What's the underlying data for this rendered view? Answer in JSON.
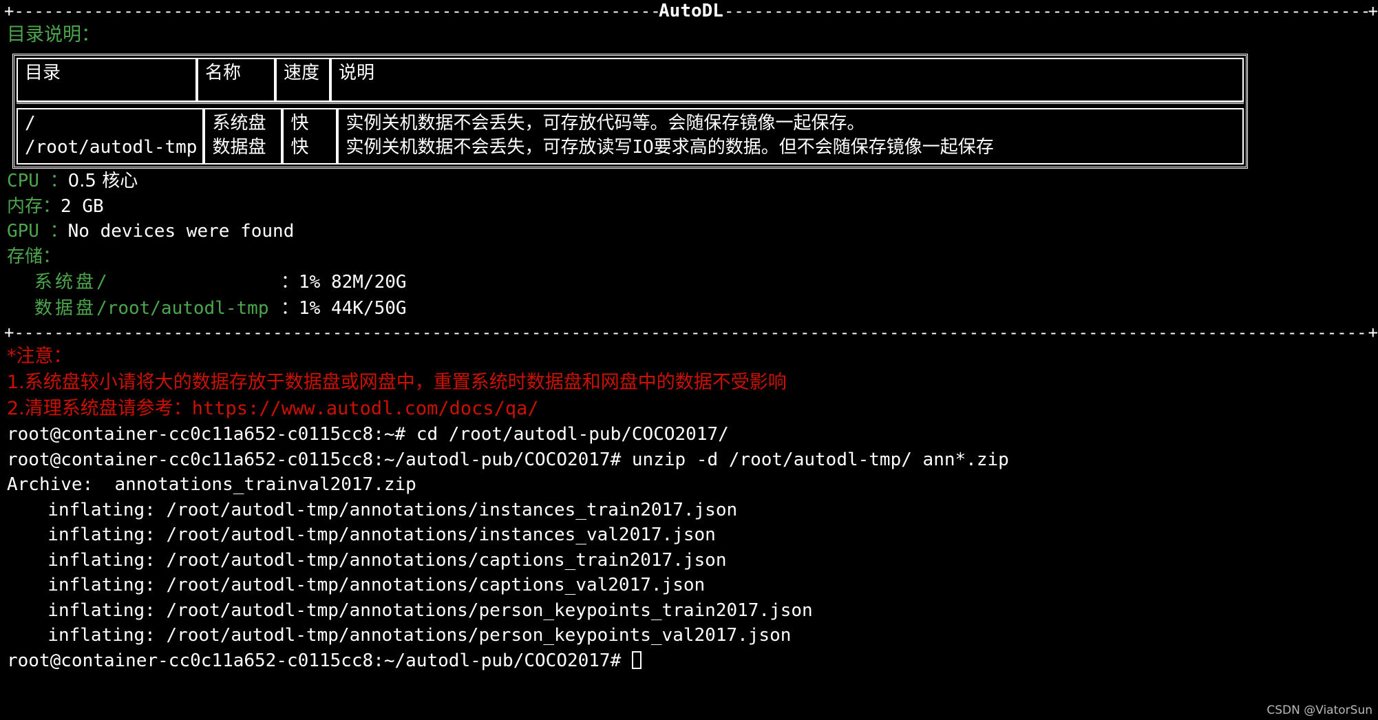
{
  "banner": {
    "title": "AutoDL",
    "plus": "+",
    "dash_char": "-"
  },
  "dir_section": {
    "heading": "目录说明：",
    "headers": [
      "目录",
      "名称",
      "速度",
      "说明"
    ],
    "rows": [
      {
        "dir": "/",
        "name": "系统盘",
        "speed": "快",
        "desc": "实例关机数据不会丢失，可存放代码等。会随保存镜像一起保存。"
      },
      {
        "dir": "/root/autodl-tmp",
        "name": "数据盘",
        "speed": "快",
        "desc": "实例关机数据不会丢失，可存放读写IO要求高的数据。但不会随保存镜像一起保存"
      }
    ]
  },
  "sysinfo": {
    "cpu_label": "CPU ：",
    "cpu_value": "0.5 核心",
    "mem_label": "内存：",
    "mem_value": "2 GB",
    "gpu_label": "GPU ：",
    "gpu_value": "No devices were found",
    "storage_label": "存储：",
    "storage": [
      {
        "name": "系统盘",
        "path": "/",
        "sep": "：",
        "usage": "1% 82M/20G"
      },
      {
        "name": "数据盘",
        "path": "/root/autodl-tmp",
        "sep": "：",
        "usage": "1% 44K/50G"
      }
    ]
  },
  "notice": {
    "heading": "*注意：",
    "lines": [
      "1.系统盘较小请将大的数据存放于数据盘或网盘中，重置系统时数据盘和网盘中的数据不受影响",
      "2.清理系统盘请参考："
    ],
    "link": "https://www.autodl.com/docs/qa/"
  },
  "terminal": {
    "prompt_user_host": "root@container-cc0c11a652-c0115cc8",
    "lines": [
      {
        "type": "command",
        "prompt": "root@container-cc0c11a652-c0115cc8:~# ",
        "text": "cd /root/autodl-pub/COCO2017/"
      },
      {
        "type": "command",
        "prompt": "root@container-cc0c11a652-c0115cc8:~/autodl-pub/COCO2017# ",
        "text": "unzip -d /root/autodl-tmp/ ann*.zip"
      },
      {
        "type": "output",
        "text": "Archive:  annotations_trainval2017.zip"
      },
      {
        "type": "output_indent",
        "text": "  inflating: /root/autodl-tmp/annotations/instances_train2017.json"
      },
      {
        "type": "output_indent",
        "text": "  inflating: /root/autodl-tmp/annotations/instances_val2017.json"
      },
      {
        "type": "output_indent",
        "text": "  inflating: /root/autodl-tmp/annotations/captions_train2017.json"
      },
      {
        "type": "output_indent",
        "text": "  inflating: /root/autodl-tmp/annotations/captions_val2017.json"
      },
      {
        "type": "output_indent",
        "text": "  inflating: /root/autodl-tmp/annotations/person_keypoints_train2017.json"
      },
      {
        "type": "output_indent",
        "text": "  inflating: /root/autodl-tmp/annotations/person_keypoints_val2017.json"
      }
    ],
    "final_prompt": "root@container-cc0c11a652-c0115cc8:~/autodl-pub/COCO2017# "
  },
  "watermark": "CSDN @ViatorSun",
  "colors": {
    "background": "#000000",
    "foreground": "#ffffff",
    "green": "#4ca64c",
    "red": "#cc1100"
  }
}
